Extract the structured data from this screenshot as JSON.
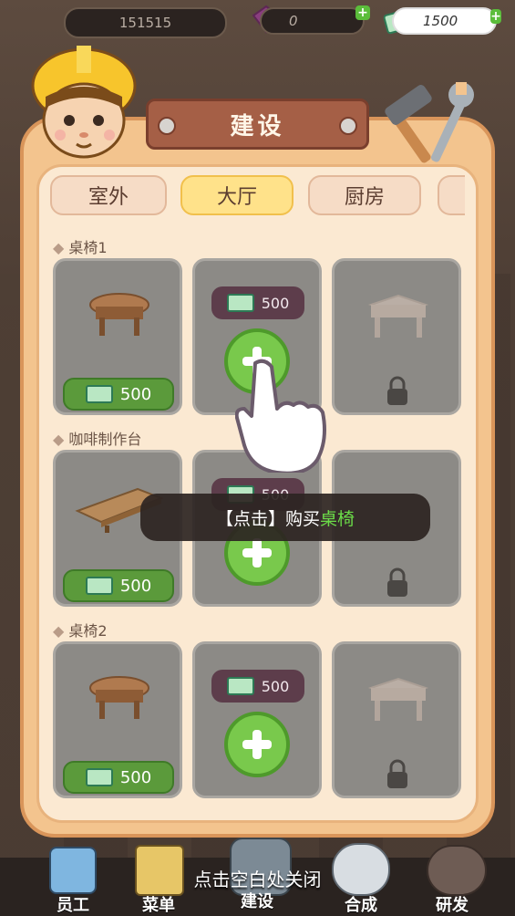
{
  "hud": {
    "coins_value": "151515",
    "gems_value": "0",
    "cash_value": "1500"
  },
  "panel": {
    "title": "建设",
    "tabs": [
      "室外",
      "大厅",
      "厨房"
    ],
    "active_tab": "大厅"
  },
  "sections": [
    {
      "title": "桌椅1",
      "cards": [
        {
          "item": "round-table",
          "price": "500",
          "state": "owned"
        },
        {
          "item": "empty",
          "price": "500",
          "state": "buy"
        },
        {
          "item": "square-table",
          "state": "locked"
        }
      ]
    },
    {
      "title": "咖啡制作台",
      "cards": [
        {
          "item": "wood-bench",
          "price": "500",
          "state": "owned"
        },
        {
          "item": "empty",
          "price": "500",
          "state": "buy"
        },
        {
          "item": "coffee-station",
          "state": "locked"
        }
      ]
    },
    {
      "title": "桌椅2",
      "cards": [
        {
          "item": "round-table",
          "price": "500",
          "state": "owned"
        },
        {
          "item": "empty",
          "price": "500",
          "state": "buy"
        },
        {
          "item": "square-table",
          "state": "locked"
        }
      ]
    }
  ],
  "toast": {
    "prefix": "【点击】购买",
    "highlight": "桌椅"
  },
  "close_hint": "点击空白处关闭",
  "bottom_nav": [
    "员工",
    "菜单",
    "建设",
    "合成",
    "研发"
  ],
  "colors": {
    "panel": "#f3c48e",
    "accent_green": "#79c94c",
    "active_tab": "#ffe28a"
  }
}
